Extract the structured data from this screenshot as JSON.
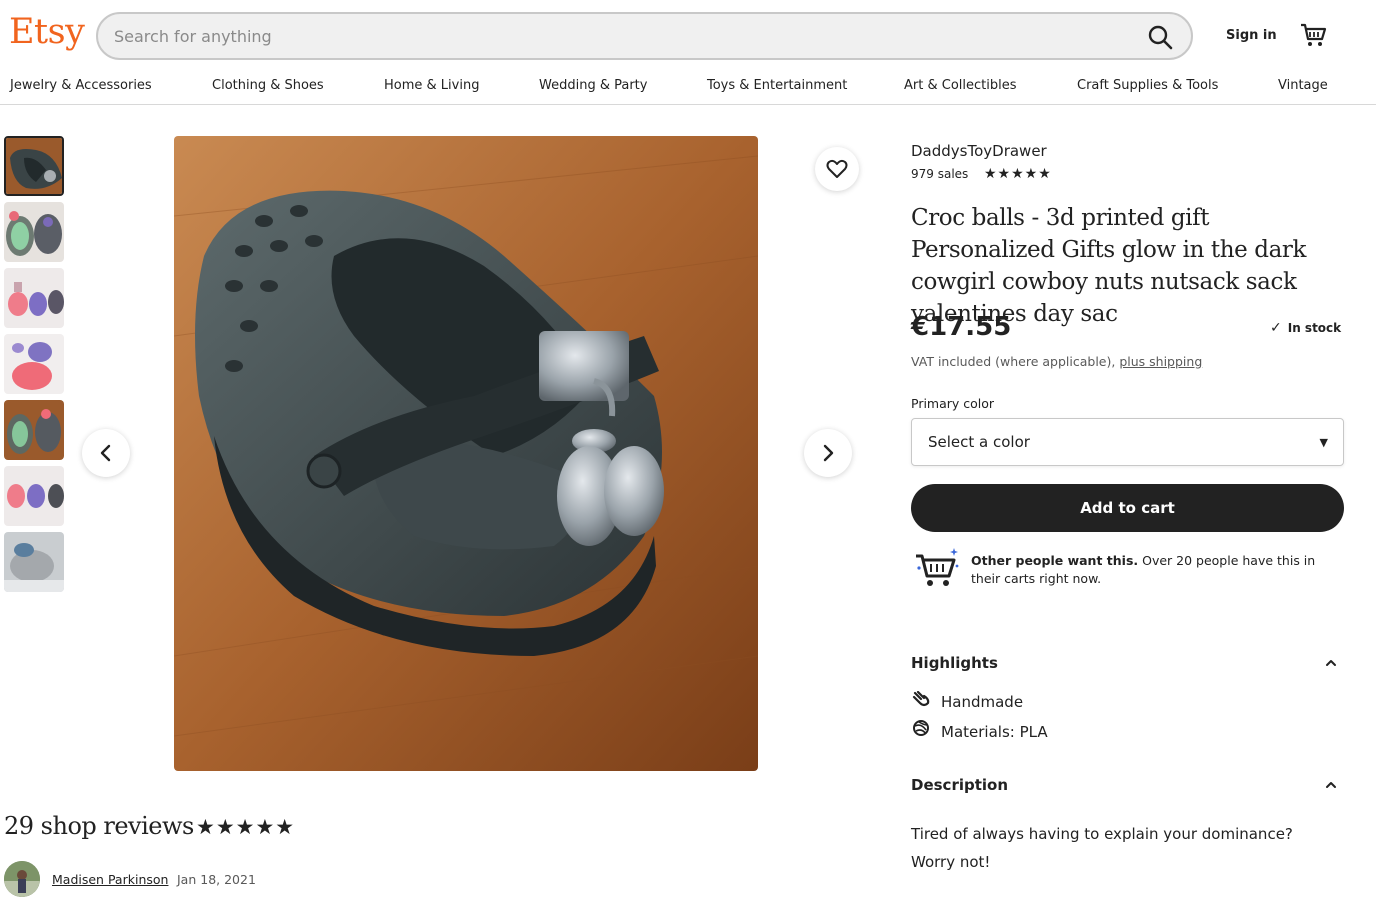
{
  "header": {
    "logo": "Etsy",
    "search_placeholder": "Search for anything",
    "sign_in": "Sign in"
  },
  "nav": [
    "Jewelry & Accessories",
    "Clothing & Shoes",
    "Home & Living",
    "Wedding & Party",
    "Toys & Entertainment",
    "Art & Collectibles",
    "Craft Supplies & Tools",
    "Vintage"
  ],
  "listing": {
    "shop_name": "DaddysToyDrawer",
    "sales": "979 sales",
    "shop_rating_stars": "★★★★★",
    "title": "Croc balls - 3d printed gift Personalized Gifts glow in the dark cowgirl cowboy nuts nutsack sack valentines day sac",
    "price": "€17.55",
    "stock": "In stock",
    "vat_text": "VAT included (where applicable),",
    "shipping_link": "plus shipping",
    "color_label": "Primary color",
    "color_select": "Select a color",
    "add_to_cart": "Add to cart",
    "demand_bold": "Other people want this.",
    "demand_text": " Over 20 people have this in their carts right now."
  },
  "highlights": {
    "heading": "Highlights",
    "items": [
      "Handmade",
      "Materials: PLA"
    ]
  },
  "description": {
    "heading": "Description",
    "lines": [
      "Tired of always having to explain your dominance?",
      "Worry not!"
    ]
  },
  "reviews": {
    "heading": "29 shop reviews",
    "stars": "★★★★★",
    "reviewer": "Madisen Parkinson",
    "date": "Jan 18, 2021"
  },
  "colors": {
    "brand": "#F1641E",
    "button": "#222222"
  }
}
